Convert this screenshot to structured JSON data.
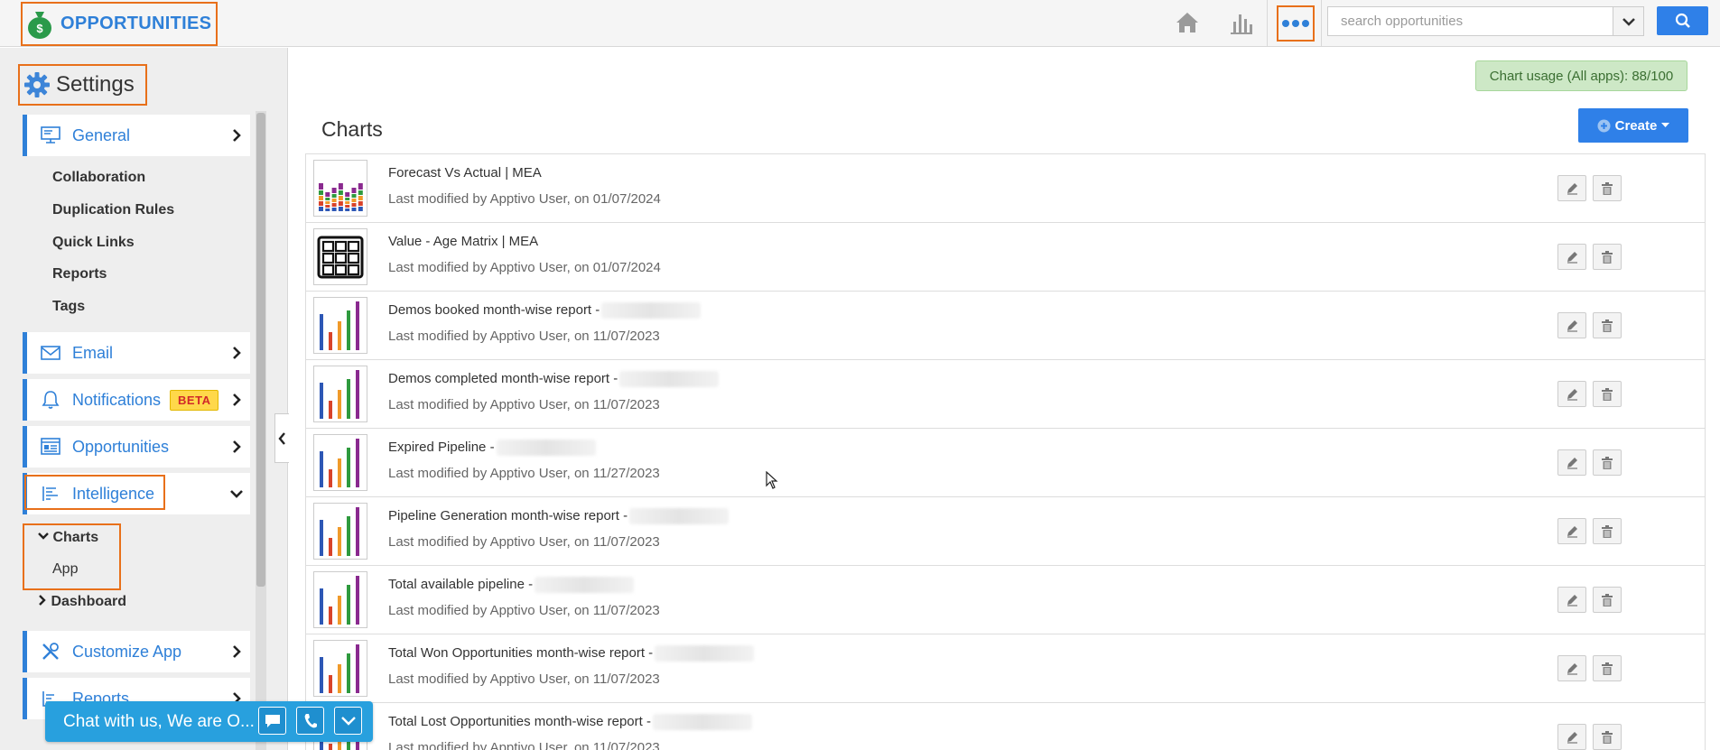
{
  "app": {
    "title": "OPPORTUNITIES"
  },
  "header": {
    "search_placeholder": "search opportunities"
  },
  "sidebar": {
    "title": "Settings",
    "general": {
      "label": "General",
      "items": [
        "Collaboration",
        "Duplication Rules",
        "Quick Links",
        "Reports",
        "Tags"
      ]
    },
    "email": "Email",
    "notifications": "Notifications",
    "beta_badge": "BETA",
    "opportunities": "Opportunities",
    "intelligence": {
      "label": "Intelligence",
      "charts": "Charts",
      "app": "App",
      "dashboard": "Dashboard"
    },
    "customize_app": "Customize App",
    "reports": "Reports"
  },
  "chat": {
    "text": "Chat with us, We are O..."
  },
  "main": {
    "usage": "Chart usage (All apps): 88/100",
    "title": "Charts",
    "create_label": "Create",
    "rows": [
      {
        "name": "Forecast Vs Actual | MEA",
        "meta": "Last modified by Apptivo User, on 01/07/2024",
        "thumb": "stacked",
        "blurred": false
      },
      {
        "name": "Value - Age Matrix | MEA",
        "meta": "Last modified by Apptivo User, on 01/07/2024",
        "thumb": "table",
        "blurred": false
      },
      {
        "name": "Demos booked month-wise report -",
        "meta": "Last modified by Apptivo User, on 11/07/2023",
        "thumb": "bars",
        "blurred": true
      },
      {
        "name": "Demos completed month-wise report -",
        "meta": "Last modified by Apptivo User, on 11/07/2023",
        "thumb": "bars",
        "blurred": true
      },
      {
        "name": "Expired Pipeline -",
        "meta": "Last modified by Apptivo User, on 11/27/2023",
        "thumb": "bars",
        "blurred": true
      },
      {
        "name": "Pipeline Generation month-wise report -",
        "meta": "Last modified by Apptivo User, on 11/07/2023",
        "thumb": "bars",
        "blurred": true
      },
      {
        "name": "Total available pipeline -",
        "meta": "Last modified by Apptivo User, on 11/07/2023",
        "thumb": "bars",
        "blurred": true
      },
      {
        "name": "Total Won Opportunities month-wise report -",
        "meta": "Last modified by Apptivo User, on 11/07/2023",
        "thumb": "bars",
        "blurred": true
      },
      {
        "name": "Total Lost Opportunities month-wise report -",
        "meta": "Last modified by Apptivo User, on 11/07/2023",
        "thumb": "bars",
        "blurred": true
      }
    ]
  },
  "colors": {
    "brand_blue": "#2f80d8",
    "highlight": "#e8701a",
    "button_blue": "#2f80e8"
  }
}
